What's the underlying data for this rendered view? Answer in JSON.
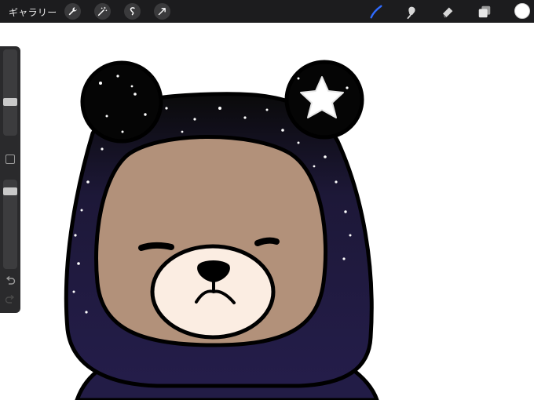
{
  "toolbar": {
    "gallery_label": "ギャラリー",
    "left_tools": [
      "wrench-icon",
      "magic-wand-icon",
      "selection-icon",
      "transform-arrow-icon"
    ],
    "right_tools": [
      "brush-icon",
      "smudge-icon",
      "eraser-icon",
      "layers-icon"
    ],
    "active_tool": "brush-icon",
    "accent_color": "#2f6bff",
    "current_color": "#ffffff"
  },
  "sidebar": {
    "brush_size_level": 0.55,
    "opacity_level": 0.12,
    "buttons": [
      "modify-square",
      "undo",
      "redo"
    ]
  },
  "canvas": {
    "subject": "bear-in-starry-hood",
    "colors": {
      "hood": "#0a0a0a",
      "fur": "#b2917a",
      "muzzle": "#fbede2",
      "sweater": "#1f1a40",
      "star": "#ffffff"
    }
  }
}
